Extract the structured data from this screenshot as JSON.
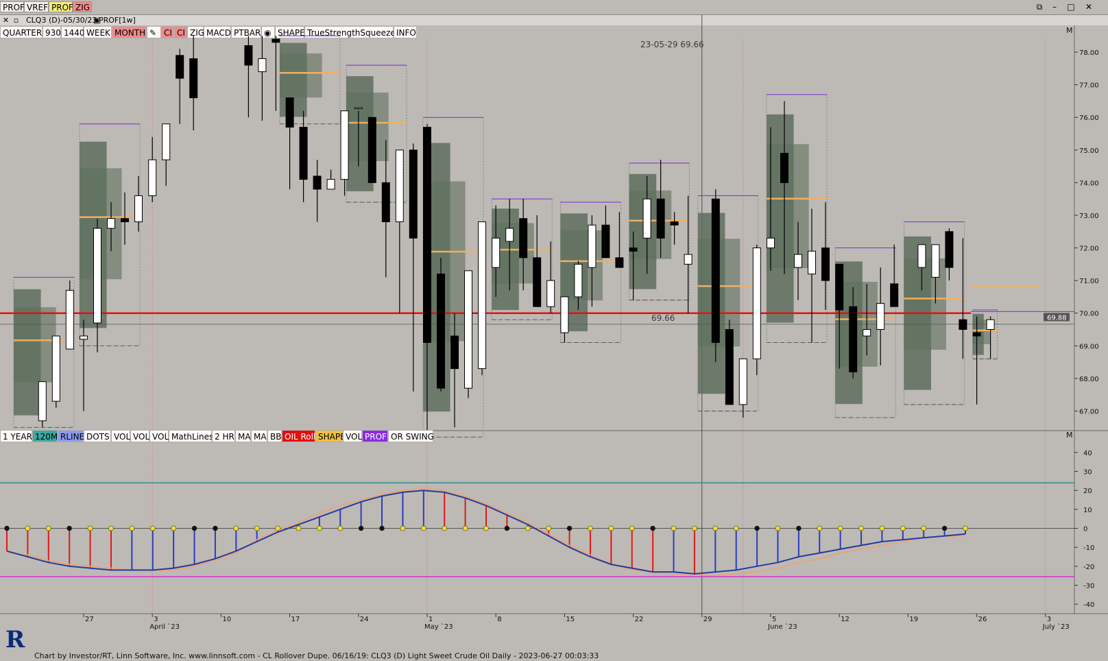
{
  "top_tabs": [
    {
      "label": "PROF",
      "bg": "#f3f1ee"
    },
    {
      "label": "VREF",
      "bg": "#f3f1ee"
    },
    {
      "label": "PROF",
      "bg": "#f7ec7a"
    },
    {
      "label": "ZIG",
      "bg": "#f08a8a"
    }
  ],
  "window_controls": {
    "restore": "⧉",
    "minimize": "–",
    "maximize": "□",
    "close": "✕"
  },
  "title": "CLQ3 (D)-05/30/23",
  "profile_label": "PROF[1w]",
  "toolbar": [
    {
      "label": "QUARTER",
      "bg": "#fbfaf8"
    },
    {
      "label": "930",
      "bg": "#fbfaf8"
    },
    {
      "label": "1440",
      "bg": "#fbfaf8"
    },
    {
      "label": "WEEK",
      "bg": "#fbfaf8"
    },
    {
      "label": "MONTH",
      "bg": "#f08a8a"
    },
    {
      "label": "✎",
      "bg": "#fbfaf8",
      "icon": "pencil-icon"
    },
    {
      "label": "CI",
      "bg": "#f08a8a"
    },
    {
      "label": "CI",
      "bg": "#f08a8a"
    },
    {
      "label": "ZIG",
      "bg": "#fbfaf8"
    },
    {
      "label": "MACD",
      "bg": "#fbfaf8"
    },
    {
      "label": "PTBAR",
      "bg": "#fbfaf8"
    },
    {
      "label": "◉",
      "bg": "#fbfaf8",
      "icon": "clock-icon"
    },
    {
      "label": "SHAPE",
      "bg": "#fbfaf8"
    },
    {
      "label": "TrueStrengthSqueeze",
      "bg": "#fbfaf8"
    },
    {
      "label": "INFO",
      "bg": "#fbfaf8"
    }
  ],
  "toolbar_lower": [
    {
      "label": "1 YEAR",
      "bg": "#fbfaf8"
    },
    {
      "label": "120M",
      "bg": "#3fa6a0"
    },
    {
      "label": "RLINE",
      "bg": "#8e9af0"
    },
    {
      "label": "DOTS",
      "bg": "#fbfaf8"
    },
    {
      "label": "VOL",
      "bg": "#fbfaf8"
    },
    {
      "label": "VOL",
      "bg": "#fbfaf8"
    },
    {
      "label": "VOL",
      "bg": "#fbfaf8"
    },
    {
      "label": "MathLines",
      "bg": "#fbfaf8"
    },
    {
      "label": "2 HR",
      "bg": "#fbfaf8"
    },
    {
      "label": "MA",
      "bg": "#fbfaf8"
    },
    {
      "label": "MA",
      "bg": "#fbfaf8"
    },
    {
      "label": "BB",
      "bg": "#fbfaf8"
    },
    {
      "label": "OIL Roll",
      "bg": "#e11010"
    },
    {
      "label": "SHAPE",
      "bg": "#f0c040"
    },
    {
      "label": "VOL",
      "bg": "#fbfaf8"
    },
    {
      "label": "PROF",
      "bg": "#8a2be2"
    },
    {
      "label": "OR SWING",
      "bg": "#fbfaf8"
    }
  ],
  "cursor_readout": "23-05-29  69.66",
  "crosshair_price": "69.66",
  "current_price": "69.88",
  "panel_letter": "M",
  "price_axis": [
    "78.00",
    "77.00",
    "76.00",
    "75.00",
    "74.00",
    "73.00",
    "72.00",
    "71.00",
    "70.00",
    "69.00",
    "68.00",
    "67.00"
  ],
  "osc_axis": [
    "40",
    "30",
    "20",
    "10",
    "0",
    "-10",
    "-20",
    "-30",
    "-40"
  ],
  "date_labels": [
    {
      "day": "27",
      "month": ""
    },
    {
      "day": "3",
      "month": "April `23"
    },
    {
      "day": "10",
      "month": ""
    },
    {
      "day": "17",
      "month": ""
    },
    {
      "day": "24",
      "month": ""
    },
    {
      "day": "1",
      "month": "May `23"
    },
    {
      "day": "8",
      "month": ""
    },
    {
      "day": "15",
      "month": ""
    },
    {
      "day": "22",
      "month": ""
    },
    {
      "day": "29",
      "month": ""
    },
    {
      "day": "5",
      "month": "June `23"
    },
    {
      "day": "12",
      "month": ""
    },
    {
      "day": "19",
      "month": ""
    },
    {
      "day": "26",
      "month": ""
    },
    {
      "day": "3",
      "month": "July `23"
    }
  ],
  "footer": "Chart by Investor/RT, Linn Software, Inc. www.linnsoft.com - CL Rollover Dupe.     06/16/19: CLQ3 (D) Light Sweet Crude Oil Daily - 2023-06-27 00:03:33",
  "chart_data": [
    {
      "type": "candlestick",
      "title": "CLQ3 (D)-05/30/23",
      "ylim": [
        66.4,
        78.4
      ],
      "x": [
        "03-22",
        "03-23",
        "03-24",
        "03-27",
        "03-28",
        "03-29",
        "03-30",
        "03-31",
        "04-03",
        "04-04",
        "04-05",
        "04-06",
        "04-12",
        "04-13",
        "04-14",
        "04-17",
        "04-18",
        "04-19",
        "04-20",
        "04-21",
        "04-24",
        "04-25",
        "04-26",
        "04-27",
        "04-28",
        "05-01",
        "05-02",
        "05-03",
        "05-04",
        "05-05",
        "05-08",
        "05-09",
        "05-10",
        "05-11",
        "05-12",
        "05-15",
        "05-16",
        "05-17",
        "05-18",
        "05-19",
        "05-22",
        "05-23",
        "05-24",
        "05-25",
        "05-26",
        "05-30",
        "05-31",
        "06-01",
        "06-02",
        "06-05",
        "06-06",
        "06-07",
        "06-08",
        "06-09",
        "06-12",
        "06-13",
        "06-14",
        "06-15",
        "06-16",
        "06-20",
        "06-21",
        "06-22",
        "06-23",
        "06-26",
        "06-27"
      ],
      "open": [
        66.7,
        67.3,
        68.9,
        69.2,
        69.7,
        72.6,
        72.9,
        72.8,
        73.6,
        74.7,
        77.9,
        77.8,
        78.2,
        77.4,
        78.4,
        76.6,
        75.7,
        74.2,
        73.8,
        74.1,
        76.3,
        76.0,
        74.0,
        72.8,
        75.0,
        75.7,
        71.2,
        69.3,
        67.7,
        68.3,
        71.4,
        72.2,
        72.9,
        71.7,
        70.2,
        69.4,
        70.5,
        71.4,
        72.7,
        71.7,
        72.0,
        72.3,
        73.5,
        72.8,
        71.5,
        73.5,
        69.5,
        67.2,
        68.6,
        72.0,
        74.9,
        71.4,
        71.2,
        72.0,
        71.5,
        70.2,
        69.3,
        69.5,
        70.9,
        71.4,
        71.1,
        72.5,
        69.8,
        69.4,
        69.5
      ],
      "high": [
        67.0,
        69.3,
        71.0,
        69.8,
        72.9,
        73.4,
        73.7,
        74.2,
        75.4,
        75.7,
        78.1,
        78.5,
        78.5,
        78.5,
        78.5,
        76.4,
        76.2,
        74.7,
        74.4,
        76.1,
        76.2,
        75.9,
        75.3,
        73.3,
        75.2,
        75.8,
        71.7,
        70.0,
        68.6,
        71.4,
        73.3,
        73.5,
        73.5,
        73.0,
        72.2,
        70.3,
        71.6,
        73.0,
        73.3,
        73.1,
        72.5,
        74.2,
        74.7,
        73.1,
        73.6,
        73.8,
        69.8,
        68.6,
        72.1,
        75.7,
        76.5,
        72.8,
        73.2,
        73.4,
        71.3,
        70.8,
        70.9,
        71.4,
        72.1,
        72.1,
        72.0,
        72.6,
        72.3,
        69.9,
        69.9
      ],
      "low": [
        66.5,
        67.1,
        68.9,
        67.0,
        68.8,
        71.9,
        72.1,
        72.5,
        73.4,
        73.9,
        75.8,
        75.6,
        76.0,
        75.9,
        76.2,
        73.8,
        73.4,
        72.8,
        73.8,
        73.6,
        74.5,
        74.0,
        71.1,
        70.0,
        67.6,
        66.2,
        67.6,
        66.5,
        67.4,
        68.1,
        70.5,
        70.7,
        70.7,
        70.4,
        70.0,
        69.1,
        70.1,
        70.2,
        71.8,
        71.5,
        70.4,
        71.2,
        71.7,
        72.1,
        70.0,
        68.5,
        67.2,
        66.8,
        68.1,
        71.3,
        71.2,
        70.4,
        69.1,
        70.1,
        68.3,
        68.0,
        68.7,
        68.4,
        70.3,
        70.7,
        70.3,
        71.0,
        68.6,
        67.2,
        68.6
      ],
      "close": [
        67.9,
        69.3,
        70.7,
        69.3,
        72.6,
        72.9,
        72.8,
        73.6,
        74.7,
        75.8,
        77.2,
        76.6,
        77.6,
        77.8,
        78.3,
        75.7,
        74.1,
        73.8,
        74.1,
        76.2,
        76.3,
        74.0,
        72.8,
        75.0,
        72.3,
        69.1,
        67.7,
        68.3,
        71.3,
        72.8,
        72.3,
        72.6,
        71.7,
        70.2,
        71.0,
        70.5,
        71.5,
        72.7,
        71.7,
        71.4,
        71.9,
        73.5,
        72.3,
        72.7,
        71.8,
        69.1,
        67.2,
        68.6,
        72.0,
        72.3,
        74.0,
        71.8,
        71.9,
        71.0,
        70.1,
        68.2,
        69.5,
        70.3,
        70.2,
        72.1,
        72.1,
        71.4,
        69.5,
        69.3,
        69.8
      ]
    },
    {
      "type": "line",
      "series": [
        {
          "name": "",
          "color": "#ff8a00",
          "values": [
            -13,
            -14,
            -17,
            -19,
            -20,
            -21,
            -22,
            -22,
            -22,
            -20,
            -17,
            -13,
            -6,
            -1,
            3,
            8,
            12,
            15,
            18,
            20,
            21,
            20,
            17,
            13,
            8,
            3,
            -3,
            -9,
            -14,
            -19,
            -22,
            -23,
            -24,
            -24,
            -25,
            -24,
            -23,
            -21,
            -18,
            -16,
            -13,
            -11,
            -9,
            -7,
            -5,
            -4,
            -4
          ]
        },
        {
          "name": "",
          "color": "#243c9c",
          "values": [
            -12,
            -15,
            -18,
            -20,
            -21,
            -22,
            -22,
            -22,
            -21,
            -19,
            -16,
            -12,
            -7,
            -2,
            2,
            6,
            10,
            14,
            17,
            19,
            20,
            19,
            16,
            12,
            7,
            2,
            -4,
            -10,
            -15,
            -19,
            -21,
            -23,
            -23,
            -24,
            -23,
            -22,
            -20,
            -18,
            -15,
            -13,
            -11,
            -9,
            -7,
            -6,
            -5,
            -4,
            -3
          ]
        }
      ],
      "ylim": [
        -45,
        45
      ]
    }
  ]
}
